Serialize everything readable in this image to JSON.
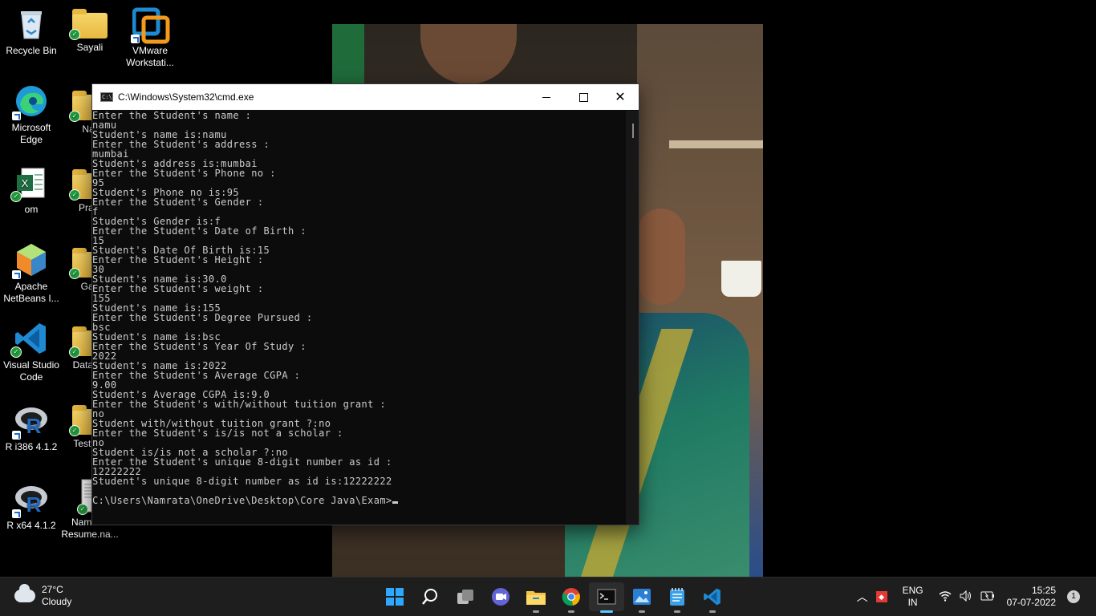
{
  "desktop": {
    "icons": [
      {
        "label": "Recycle Bin"
      },
      {
        "label": "Sayali"
      },
      {
        "label": "VMware Workstati..."
      },
      {
        "label": "Microsoft Edge"
      },
      {
        "label": "Nar"
      },
      {
        "label": "om"
      },
      {
        "label": "Pract"
      },
      {
        "label": "Apache NetBeans I..."
      },
      {
        "label": "Gad"
      },
      {
        "label": "Visual Studio Code"
      },
      {
        "label": "Data Sc"
      },
      {
        "label": "R i386 4.1.2"
      },
      {
        "label": "Test jun"
      },
      {
        "label": "R x64 4.1.2"
      },
      {
        "label": "Namrata Resume.na..."
      }
    ]
  },
  "cmd": {
    "title": "C:\\Windows\\System32\\cmd.exe",
    "icon_text": "C:\\",
    "output": "Enter the Student's name :\nnamu\nStudent's name is:namu\nEnter the Student's address :\nmumbai\nStudent's address is:mumbai\nEnter the Student's Phone no :\n95\nStudent's Phone no is:95\nEnter the Student's Gender :\nf\nStudent's Gender is:f\nEnter the Student's Date of Birth :\n15\nStudent's Date Of Birth is:15\nEnter the Student's Height :\n30\nStudent's name is:30.0\nEnter the Student's weight :\n155\nStudent's name is:155\nEnter the Student's Degree Pursued :\nbsc\nStudent's name is:bsc\nEnter the Student's Year Of Study :\n2022\nStudent's name is:2022\nEnter the Student's Average CGPA :\n9.00\nStudent's Average CGPA is:9.0\nEnter the Student's with/without tuition grant :\nno\nStudent with/without tuition grant ?:no\nEnter the Student's is/is not a scholar :\nno\nStudent is/is not a scholar ?:no\nEnter the Student's unique 8-digit number as id :\n12222222\nStudent's unique 8-digit number as id is:12222222\n\nC:\\Users\\Namrata\\OneDrive\\Desktop\\Core Java\\Exam>"
  },
  "taskbar": {
    "weather_temp": "27°C",
    "weather_desc": "Cloudy",
    "lang_top": "ENG",
    "lang_bottom": "IN",
    "time": "15:25",
    "date": "07-07-2022",
    "notification_count": "1"
  },
  "colors": {
    "console_bg": "#0c0c0c",
    "console_text": "#cccccc",
    "taskbar_bg": "#1e1e1e",
    "accent": "#2ea7ff"
  }
}
